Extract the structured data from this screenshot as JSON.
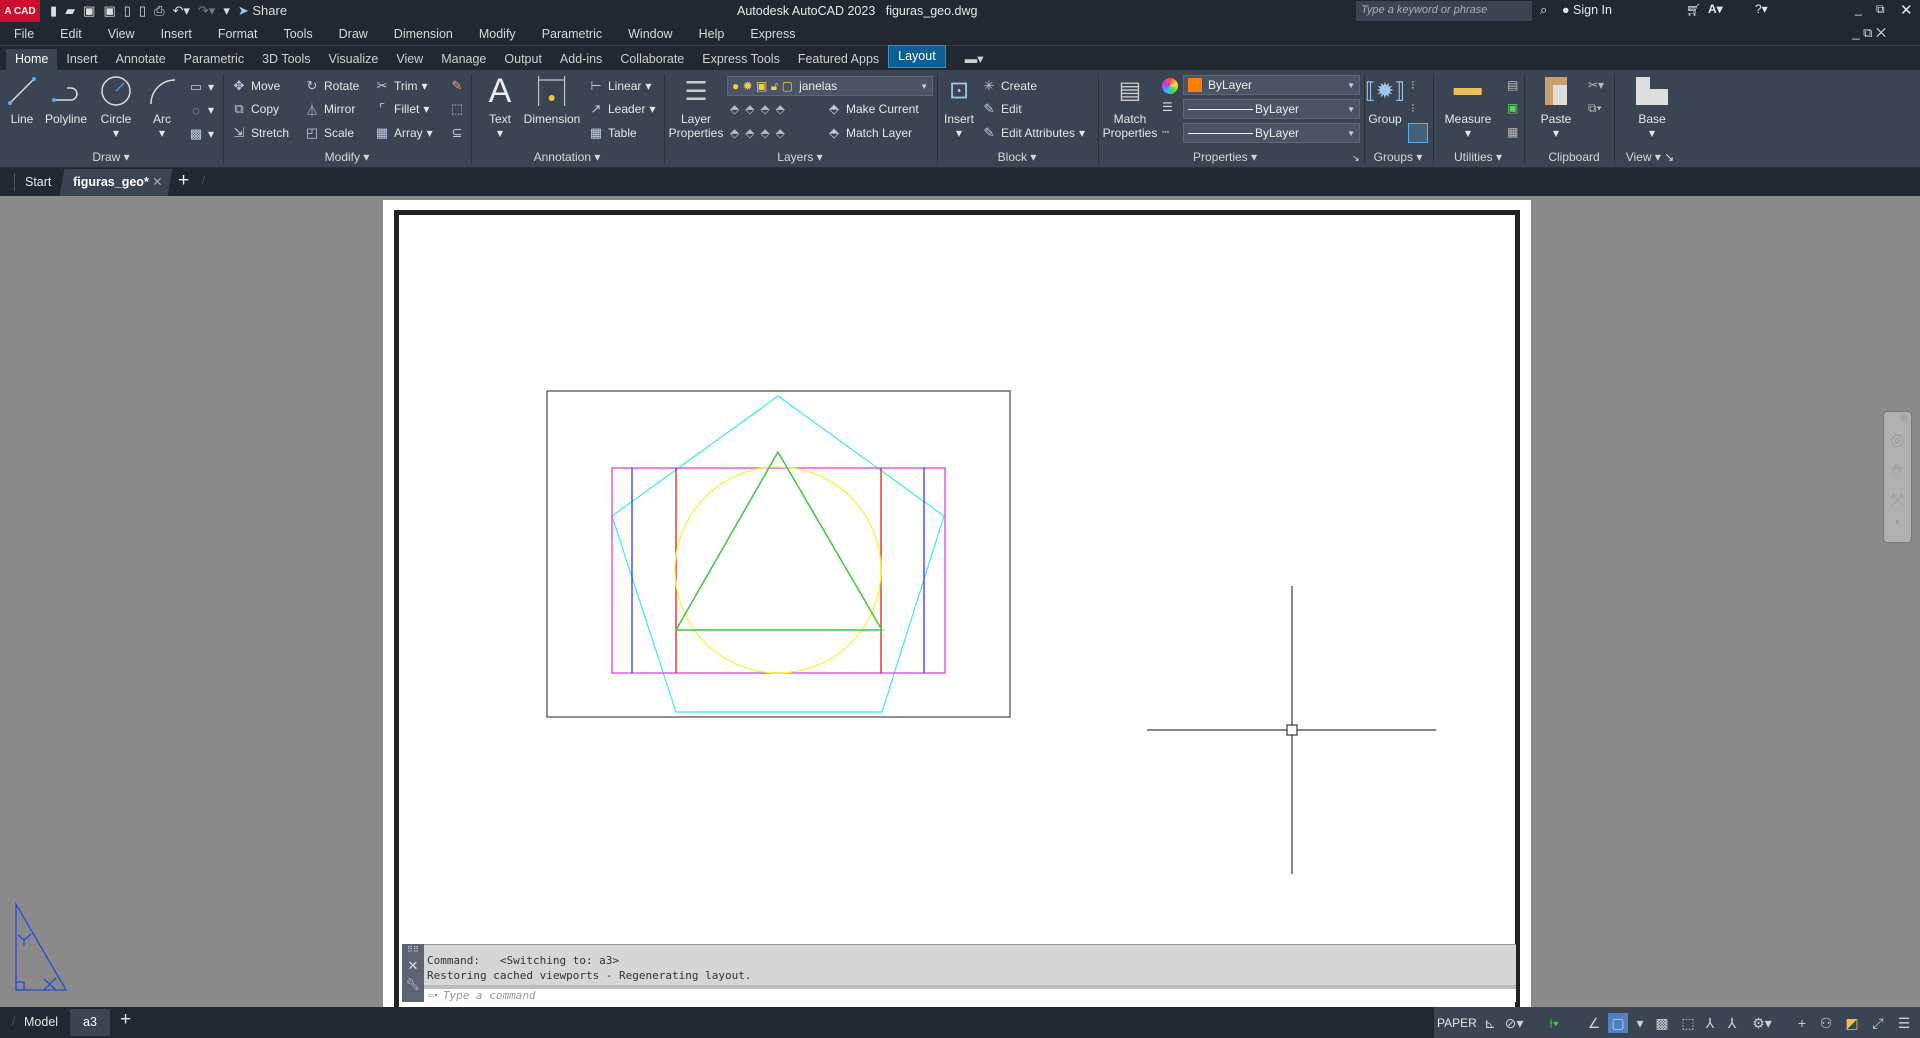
{
  "app": {
    "title": "Autodesk AutoCAD 2023",
    "file": "figuras_geo.dwg",
    "logo": "A CAD",
    "share": "Share",
    "search_placeholder": "Type a keyword or phrase",
    "sign_in": "Sign In"
  },
  "menu": [
    "File",
    "Edit",
    "View",
    "Insert",
    "Format",
    "Tools",
    "Draw",
    "Dimension",
    "Modify",
    "Parametric",
    "Window",
    "Help",
    "Express"
  ],
  "ribbon_tabs": [
    "Home",
    "Insert",
    "Annotate",
    "Parametric",
    "3D Tools",
    "Visualize",
    "View",
    "Manage",
    "Output",
    "Add-ins",
    "Collaborate",
    "Express Tools",
    "Featured Apps",
    "Layout"
  ],
  "ribbon": {
    "draw": {
      "title": "Draw",
      "line": "Line",
      "polyline": "Polyline",
      "circle": "Circle",
      "arc": "Arc"
    },
    "modify": {
      "title": "Modify",
      "move": "Move",
      "rotate": "Rotate",
      "trim": "Trim",
      "copy": "Copy",
      "mirror": "Mirror",
      "fillet": "Fillet",
      "stretch": "Stretch",
      "scale": "Scale",
      "array": "Array"
    },
    "annotation": {
      "title": "Annotation",
      "text": "Text",
      "dimension": "Dimension",
      "linear": "Linear",
      "leader": "Leader",
      "table": "Table"
    },
    "layers": {
      "title": "Layers",
      "layer_properties_1": "Layer",
      "layer_properties_2": "Properties",
      "current_layer": "janelas",
      "make_current": "Make Current",
      "match_layer": "Match Layer"
    },
    "block": {
      "title": "Block",
      "insert": "Insert",
      "create": "Create",
      "edit": "Edit",
      "edit_attributes": "Edit Attributes"
    },
    "properties": {
      "title": "Properties",
      "match_1": "Match",
      "match_2": "Properties",
      "color": "ByLayer",
      "lineweight": "ByLayer",
      "linetype": "ByLayer",
      "color_swatch": "#ff7f00"
    },
    "groups": {
      "title": "Groups",
      "group": "Group"
    },
    "utilities": {
      "title": "Utilities",
      "measure": "Measure"
    },
    "clipboard": {
      "title": "Clipboard",
      "paste": "Paste"
    },
    "view": {
      "title": "View",
      "base": "Base"
    }
  },
  "file_tabs": {
    "start": "Start",
    "active": "figuras_geo*"
  },
  "command": {
    "line1": "Command:   <Switching to: a3>",
    "line2": "Restoring cached viewports - Regenerating layout.",
    "placeholder": "Type a command"
  },
  "layout_tabs": {
    "model": "Model",
    "active": "a3"
  },
  "status": {
    "paper": "PAPER"
  },
  "colors": {
    "pentagon": "#3ee8f0",
    "rect_outer": "#e040e8",
    "rect_blue": "#3a3ae8",
    "rect_red": "#e02020",
    "circle": "#f5f542",
    "triangle": "#3cc83c",
    "accent": "#0e5f96"
  }
}
